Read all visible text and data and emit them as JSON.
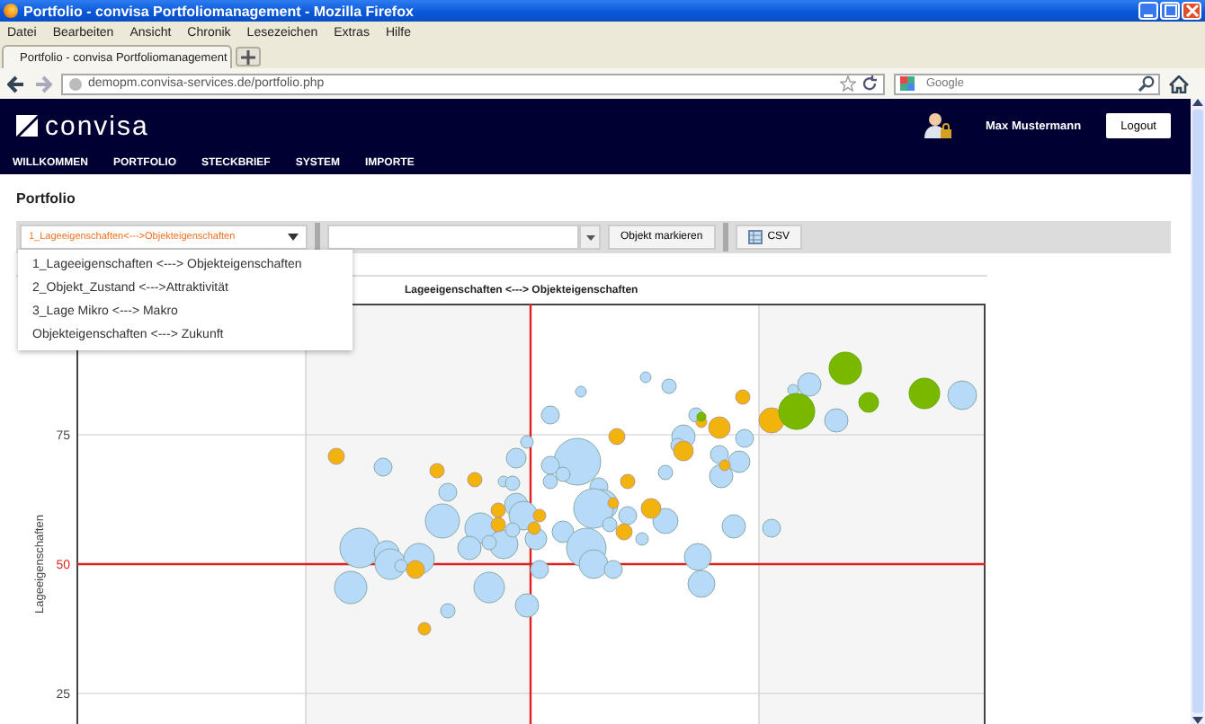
{
  "browser": {
    "title": "Portfolio - convisa Portfoliomanagement - Mozilla Firefox",
    "menu": [
      "Datei",
      "Bearbeiten",
      "Ansicht",
      "Chronik",
      "Lesezeichen",
      "Extras",
      "Hilfe"
    ],
    "tab": "Portfolio - convisa Portfoliomanagement",
    "url": "demopm.convisa-services.de/portfolio.php",
    "search_placeholder": "Google"
  },
  "app": {
    "logo": "convisa",
    "user": "Max Mustermann",
    "logout": "Logout",
    "nav": [
      "WILLKOMMEN",
      "PORTFOLIO",
      "STECKBRIEF",
      "SYSTEM",
      "IMPORTE"
    ]
  },
  "page": {
    "title": "Portfolio",
    "select_value": "1_Lageeigenschaften<--->Objekteigenschaften",
    "mark_button": "Objekt markieren",
    "csv_button": "CSV",
    "dropdown_options": [
      "1_Lageeigenschaften <---> Objekteigenschaften",
      "2_Objekt_Zustand <--->Attraktivität",
      "3_Lage Mikro <---> Makro",
      "Objekteigenschaften <---> Zukunft"
    ]
  },
  "chart": {
    "title": "Lageeigenschaften <---> Objekteigenschaften",
    "ylabel": "Lageeigenschaften",
    "yticks": [
      "75",
      "50",
      "25"
    ]
  }
}
